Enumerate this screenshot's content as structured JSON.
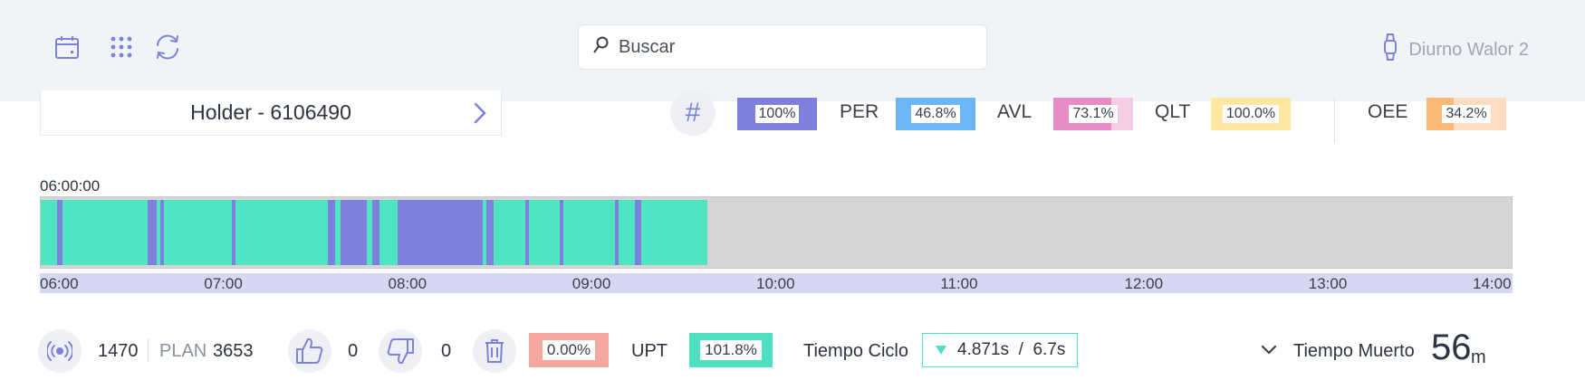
{
  "topbar": {
    "icons": [
      "calendar-icon",
      "apps-grid-icon",
      "refresh-icon"
    ],
    "search": {
      "placeholder": "Buscar",
      "value": ""
    },
    "user": {
      "name": "Diurno Walor 2",
      "icon": "watch-icon"
    }
  },
  "holder": {
    "label": "Holder - 6106490"
  },
  "kpis": [
    {
      "label": "",
      "value": "100%",
      "fraction": 1.0,
      "color": "#7d80dc",
      "track": "#c9caf1"
    },
    {
      "label": "PER",
      "value": "46.8%",
      "fraction": 1.0,
      "color": "#6cb6f8",
      "track": "#c7e3fc"
    },
    {
      "label": "AVL",
      "value": "73.1%",
      "fraction": 0.731,
      "color": "#e88cc6",
      "track": "#f4cde4"
    },
    {
      "label": "QLT",
      "value": "100.0%",
      "fraction": 1.0,
      "color": "#fde8a2",
      "track": "#fde8a2"
    },
    {
      "label": "OEE",
      "value": "34.2%",
      "fraction": 0.342,
      "color": "#fbb877",
      "track": "#fddcbf"
    }
  ],
  "timeline": {
    "start_label": "06:00:00",
    "range_hours": [
      6,
      14
    ],
    "colors": {
      "running": "#4fe5c2",
      "stop": "#7d80dc",
      "empty": "#d5d5d5"
    },
    "segments": [
      {
        "state": "running",
        "start": 6.0,
        "end": 6.09
      },
      {
        "state": "stop",
        "start": 6.09,
        "end": 6.12
      },
      {
        "state": "running",
        "start": 6.12,
        "end": 6.58
      },
      {
        "state": "stop",
        "start": 6.58,
        "end": 6.63
      },
      {
        "state": "running",
        "start": 6.63,
        "end": 6.65
      },
      {
        "state": "stop",
        "start": 6.65,
        "end": 6.67
      },
      {
        "state": "running",
        "start": 6.67,
        "end": 7.04
      },
      {
        "state": "stop",
        "start": 7.04,
        "end": 7.06
      },
      {
        "state": "running",
        "start": 7.06,
        "end": 7.56
      },
      {
        "state": "stop",
        "start": 7.56,
        "end": 7.6
      },
      {
        "state": "running",
        "start": 7.6,
        "end": 7.63
      },
      {
        "state": "stop",
        "start": 7.63,
        "end": 7.77
      },
      {
        "state": "running",
        "start": 7.77,
        "end": 7.8
      },
      {
        "state": "stop",
        "start": 7.8,
        "end": 7.84
      },
      {
        "state": "running",
        "start": 7.84,
        "end": 7.94
      },
      {
        "state": "stop",
        "start": 7.94,
        "end": 8.4
      },
      {
        "state": "running",
        "start": 8.4,
        "end": 8.42
      },
      {
        "state": "stop",
        "start": 8.42,
        "end": 8.46
      },
      {
        "state": "running",
        "start": 8.46,
        "end": 8.63
      },
      {
        "state": "stop",
        "start": 8.63,
        "end": 8.65
      },
      {
        "state": "running",
        "start": 8.65,
        "end": 8.82
      },
      {
        "state": "stop",
        "start": 8.82,
        "end": 8.84
      },
      {
        "state": "running",
        "start": 8.84,
        "end": 9.12
      },
      {
        "state": "stop",
        "start": 9.12,
        "end": 9.14
      },
      {
        "state": "running",
        "start": 9.14,
        "end": 9.23
      },
      {
        "state": "stop",
        "start": 9.23,
        "end": 9.26
      },
      {
        "state": "running",
        "start": 9.26,
        "end": 9.62
      }
    ],
    "ticks": [
      "06:00",
      "07:00",
      "08:00",
      "09:00",
      "10:00",
      "11:00",
      "12:00",
      "13:00",
      "14:00"
    ]
  },
  "bottom": {
    "count": "1470",
    "plan_label": "PLAN",
    "plan_value": "3653",
    "good": "0",
    "bad": "0",
    "scrap_pct": "0.00%",
    "upt_label": "UPT",
    "upt_value": "101.8%",
    "ciclo_label": "Tiempo Ciclo",
    "ciclo_value": "4.871s  /  6.7s",
    "muerto_label": "Tiempo Muerto",
    "muerto_value": "56",
    "muerto_unit": "m",
    "colors": {
      "scrap": "#f7a7a2",
      "upt": "#4fe0c1",
      "icon": "#7d83d9"
    }
  }
}
